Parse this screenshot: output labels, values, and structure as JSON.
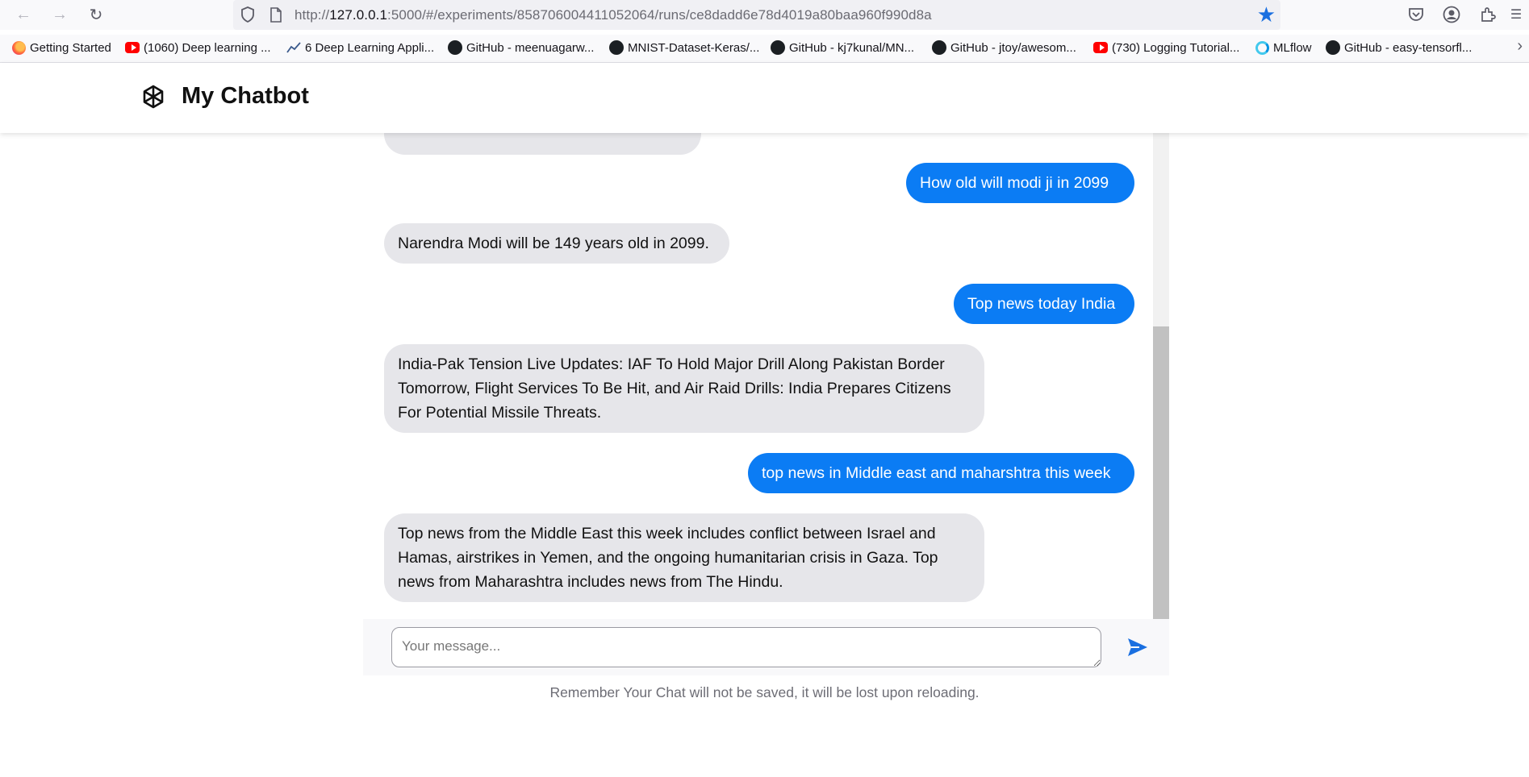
{
  "browser": {
    "url_prefix": "http://",
    "url_host": "127.0.0.1",
    "url_rest": ":5000/#/experiments/858706004411052064/runs/ce8dadd6e78d4019a80baa960f990d8a",
    "bookmarks": [
      {
        "icon": "firefox-icon",
        "label": "Getting Started"
      },
      {
        "icon": "youtube-icon",
        "label": "(1060) Deep learning ..."
      },
      {
        "icon": "trend-icon",
        "label": "6 Deep Learning Appli..."
      },
      {
        "icon": "github-icon",
        "label": "GitHub - meenuagarw..."
      },
      {
        "icon": "github-icon",
        "label": "MNIST-Dataset-Keras/..."
      },
      {
        "icon": "github-icon",
        "label": "GitHub - kj7kunal/MN..."
      },
      {
        "icon": "github-icon",
        "label": "GitHub - jtoy/awesom..."
      },
      {
        "icon": "youtube-icon",
        "label": "(730) Logging Tutorial..."
      },
      {
        "icon": "mlflow-icon",
        "label": "MLflow"
      },
      {
        "icon": "github-icon",
        "label": "GitHub - easy-tensorfl..."
      }
    ]
  },
  "app": {
    "title": "My Chatbot",
    "input_placeholder": "Your message...",
    "footer_note": "Remember Your Chat will not be saved, it will be lost upon reloading.",
    "accent_color": "#0b7cf4"
  },
  "messages": [
    {
      "role": "user",
      "text": "How old will modi ji in 2099"
    },
    {
      "role": "bot",
      "text": "Narendra Modi will be 149 years old in 2099."
    },
    {
      "role": "user",
      "text": "Top news today India"
    },
    {
      "role": "bot",
      "text": "India-Pak Tension Live Updates: IAF To Hold Major Drill Along Pakistan Border Tomorrow, Flight Services To Be Hit, and Air Raid Drills: India Prepares Citizens For Potential Missile Threats."
    },
    {
      "role": "user",
      "text": "top news in Middle east and maharshtra this week"
    },
    {
      "role": "bot",
      "text": "Top news from the Middle East this week includes conflict between Israel and Hamas, airstrikes in Yemen, and the ongoing humanitarian crisis in Gaza. Top news from Maharashtra includes news from The Hindu."
    }
  ]
}
